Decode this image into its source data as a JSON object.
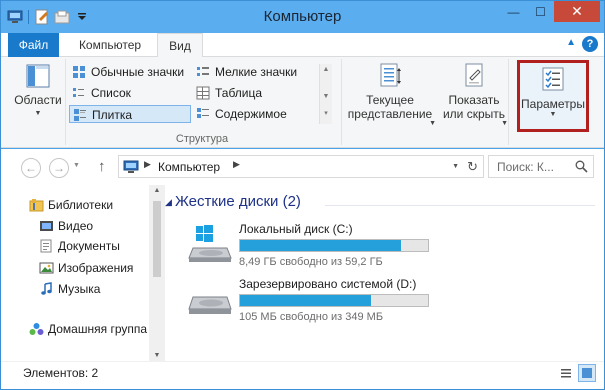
{
  "window": {
    "title": "Компьютер",
    "quick_access": [
      "computer-icon",
      "properties-icon",
      "new-folder-icon",
      "qat-dropdown-icon"
    ],
    "controls": {
      "minimize": "—",
      "maximize": "☐",
      "close": "✕"
    }
  },
  "ribbon_tabs": [
    {
      "label": "Файл",
      "active": false
    },
    {
      "label": "Компьютер",
      "active": false
    },
    {
      "label": "Вид",
      "active": true
    }
  ],
  "ribbon": {
    "areas": {
      "label": "Области",
      "icon": "navigation-pane-icon"
    },
    "layout": {
      "group_label": "Структура",
      "items": [
        {
          "label": "Обычные значки",
          "icon": "medium-icons-icon",
          "selected": false
        },
        {
          "label": "Мелкие значки",
          "icon": "small-icons-icon",
          "selected": false
        },
        {
          "label": "Список",
          "icon": "list-icon",
          "selected": false
        },
        {
          "label": "Таблица",
          "icon": "details-icon",
          "selected": false
        },
        {
          "label": "Плитка",
          "icon": "tiles-icon",
          "selected": true
        },
        {
          "label": "Содержимое",
          "icon": "content-icon",
          "selected": false
        }
      ]
    },
    "current_view": {
      "line1": "Текущее",
      "line2": "представление",
      "icon": "current-view-icon"
    },
    "show_hide": {
      "line1": "Показать",
      "line2": "или скрыть",
      "icon": "show-hide-icon"
    },
    "options": {
      "label": "Параметры",
      "icon": "options-icon",
      "highlighted": true
    }
  },
  "address_bar": {
    "path": "Компьютер",
    "search_placeholder": "Поиск: К..."
  },
  "nav_pane": {
    "items": [
      {
        "label": "Библиотеки",
        "icon": "libraries-icon",
        "level": 0
      },
      {
        "label": "Видео",
        "icon": "video-icon",
        "level": 1
      },
      {
        "label": "Документы",
        "icon": "documents-icon",
        "level": 1
      },
      {
        "label": "Изображения",
        "icon": "pictures-icon",
        "level": 1
      },
      {
        "label": "Музыка",
        "icon": "music-icon",
        "level": 1
      },
      {
        "label": "Домашняя группа",
        "icon": "homegroup-icon",
        "level": 0
      }
    ]
  },
  "content": {
    "section_title": "Жесткие диски (2)",
    "drives": [
      {
        "name": "Локальный диск (C:)",
        "free_text": "8,49 ГБ свободно из 59,2 ГБ",
        "used_fraction": 0.857,
        "icon": "windows-drive-icon"
      },
      {
        "name": "Зарезервировано системой (D:)",
        "free_text": "105 МБ свободно из 349 МБ",
        "used_fraction": 0.699,
        "icon": "hard-drive-icon"
      }
    ]
  },
  "status": {
    "items": "Элементов: 2"
  },
  "colors": {
    "accent": "#1979ca",
    "title_bar": "#5aaef0",
    "drive_bar": "#26a0da",
    "highlight_border": "#b21f1f"
  }
}
